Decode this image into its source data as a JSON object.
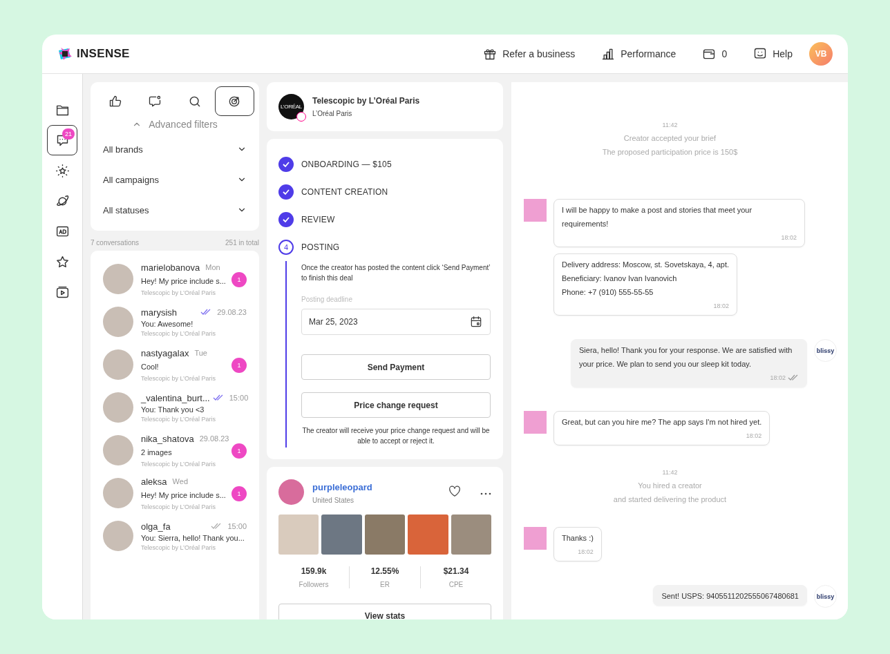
{
  "header": {
    "logo": "INSENSE",
    "nav": [
      {
        "kind": "gift",
        "label": "Refer a business"
      },
      {
        "kind": "chart",
        "label": "Performance"
      },
      {
        "kind": "wallet",
        "label": "0"
      },
      {
        "kind": "help",
        "label": "Help"
      }
    ],
    "avatar": "VB"
  },
  "rail": [
    {
      "kind": "folder",
      "selected": false
    },
    {
      "kind": "chat",
      "selected": true,
      "badge": "21"
    },
    {
      "kind": "sparkle",
      "selected": false
    },
    {
      "kind": "planet",
      "selected": false
    },
    {
      "kind": "ad",
      "selected": false
    },
    {
      "kind": "star",
      "selected": false
    },
    {
      "kind": "video",
      "selected": false
    }
  ],
  "filters": {
    "tabs": [
      {
        "kind": "like",
        "selected": false
      },
      {
        "kind": "comment",
        "selected": false
      },
      {
        "kind": "search",
        "selected": false
      },
      {
        "kind": "target",
        "selected": true
      }
    ],
    "advanced": {
      "label": "Advanced filters",
      "expanded": true
    },
    "dropdowns": [
      "All brands",
      "All campaigns",
      "All statuses"
    ]
  },
  "conversations_summary": {
    "count": "7 conversations",
    "total": "251 in total"
  },
  "conversations": [
    {
      "name": "marielobanova",
      "time": "Mon",
      "preview": "Hey! My price include s...",
      "campaign": "Telescopic by L’Oréal Paris",
      "unread": "1",
      "ticks": false
    },
    {
      "name": "marysish",
      "time": "29.08.23",
      "preview": "You: Awesome!",
      "campaign": "Telescopic by L’Oréal Paris",
      "ticks": true,
      "read": true
    },
    {
      "name": "nastyagalax",
      "time": "Tue",
      "preview": "Cool!",
      "campaign": "Telescopic by L’Oréal Paris",
      "unread": "1",
      "ticks": false
    },
    {
      "name": "_valentina_burt...",
      "time": "15:00",
      "preview": "You: Thank you <3",
      "campaign": "Telescopic by L’Oréal Paris",
      "ticks": true,
      "read": true
    },
    {
      "name": "nika_shatova",
      "time": "29.08.23",
      "preview": "2 images",
      "campaign": "Telescopic by L’Oréal Paris",
      "unread": "1",
      "ticks": false
    },
    {
      "name": "aleksa",
      "time": "Wed",
      "preview": "Hey! My price include s...",
      "campaign": "Telescopic by L’Oréal Paris",
      "unread": "1",
      "ticks": false
    },
    {
      "name": "olga_fa",
      "time": "15:00",
      "preview": "You: Sierra, hello! Thank you...",
      "campaign": "Telescopic by L’Oréal Paris",
      "ticks": true,
      "read": false
    }
  ],
  "campaign": {
    "logo": "L’ORÉAL",
    "title": "Telescopic by L’Oréal Paris",
    "brand": "L’Oréal Paris"
  },
  "steps": [
    {
      "label": "ONBOARDING — $105",
      "done": true
    },
    {
      "label": "CONTENT CREATION",
      "done": true
    },
    {
      "label": "REVIEW",
      "done": true
    },
    {
      "label": "POSTING",
      "number": "4",
      "done": false
    }
  ],
  "posting": {
    "instruction": "Once the creator has posted the content click ‘Send Payment’ to finish this deal",
    "deadline_label": "Posting deadline",
    "deadline_value": "Mar 25, 2023",
    "buttons": [
      "Send Payment",
      "Price change request"
    ],
    "note": "The creator will receive your price change request and will be able to accept or reject it."
  },
  "creator": {
    "name": "purpleleopard",
    "country": "United States",
    "liked": false,
    "stats": [
      {
        "value": "159.9k",
        "label": "Followers"
      },
      {
        "value": "12.55%",
        "label": "ER"
      },
      {
        "value": "$21.34",
        "label": "CPE"
      }
    ],
    "button": "View stats"
  },
  "chat": [
    {
      "kind": "system",
      "time": "11:42",
      "lines": [
        "Creator accepted your brief",
        "The proposed participation price is 150$"
      ]
    },
    {
      "kind": "incoming",
      "lines": [
        "I will be happy to make a post and stories that meet your requirements!"
      ],
      "time": "18:02",
      "avatar": true
    },
    {
      "kind": "incoming",
      "lines": [
        "Delivery address: Moscow, st. Sovetskaya, 4, apt.",
        "Beneficiary: Ivanov Ivan Ivanovich",
        "Phone: +7 (910) 555-55-55"
      ],
      "time": "18:02",
      "avatar": false
    },
    {
      "kind": "outgoing",
      "lines": [
        "Siera, hello! Thank you for your response. We are satisfied with your price. We plan to send you our sleep kit today."
      ],
      "time": "18:02",
      "sender": "blissy",
      "read": true
    },
    {
      "kind": "incoming",
      "lines": [
        "Great, but can you hire me? The app says I'm not hired yet."
      ],
      "time": "18:02",
      "avatar": true
    },
    {
      "kind": "system",
      "time": "11:42",
      "lines": [
        "You hired a creator",
        "and started delivering the product"
      ]
    },
    {
      "kind": "incoming",
      "lines": [
        "Thanks :)"
      ],
      "time": "18:02",
      "avatar": true
    },
    {
      "kind": "outgoing",
      "lines": [
        "Sent! USPS: 9405511202555067480681"
      ],
      "sender": "blissy"
    }
  ]
}
